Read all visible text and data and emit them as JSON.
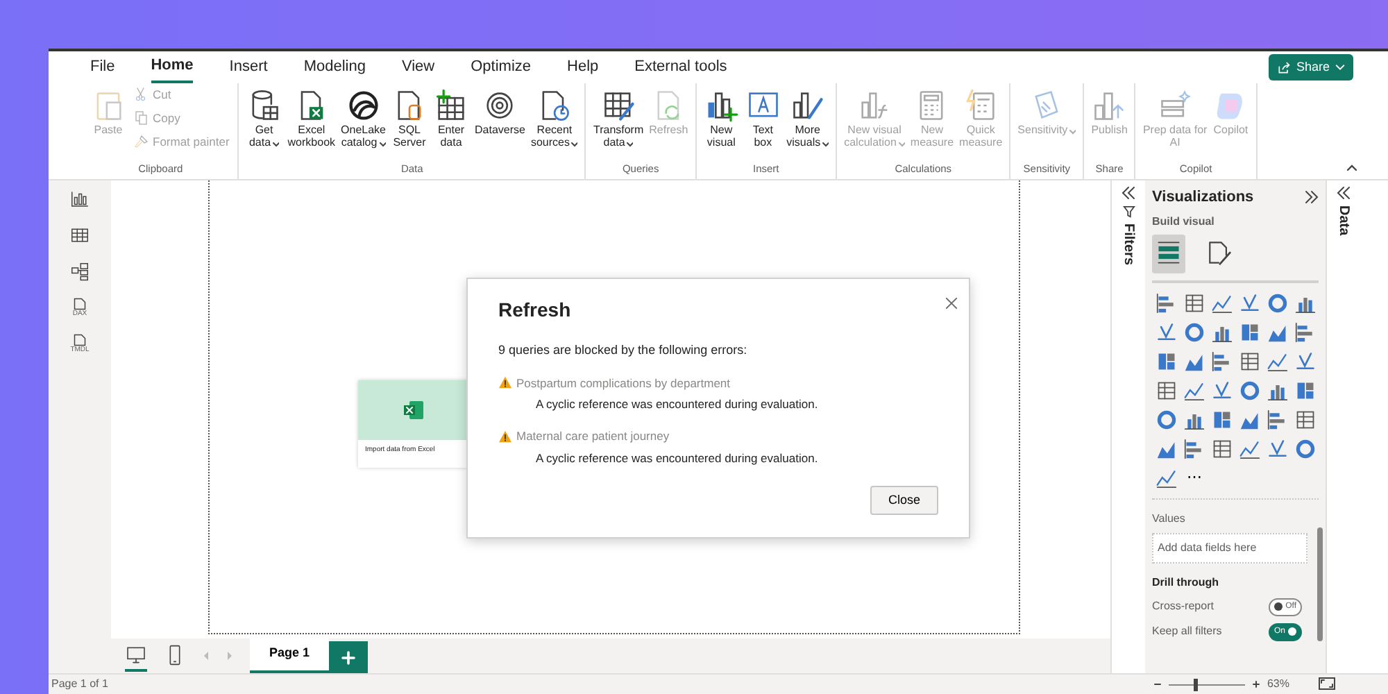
{
  "menu_tabs": [
    {
      "label": "File",
      "selected": false
    },
    {
      "label": "Home",
      "selected": true
    },
    {
      "label": "Insert",
      "selected": false
    },
    {
      "label": "Modeling",
      "selected": false
    },
    {
      "label": "View",
      "selected": false
    },
    {
      "label": "Optimize",
      "selected": false
    },
    {
      "label": "Help",
      "selected": false
    },
    {
      "label": "External tools",
      "selected": false
    }
  ],
  "share_button": {
    "label": "Share"
  },
  "ribbon": {
    "groups": [
      {
        "label": "Clipboard",
        "buttons": [
          {
            "kind": "large",
            "label": "Paste",
            "disabled": true,
            "dropdown": false
          },
          {
            "kind": "small",
            "label": "Cut",
            "disabled": true
          },
          {
            "kind": "small",
            "label": "Copy",
            "disabled": true
          },
          {
            "kind": "small",
            "label": "Format painter",
            "disabled": true
          }
        ]
      },
      {
        "label": "Data",
        "buttons": [
          {
            "kind": "large",
            "label": "Get\ndata",
            "disabled": false,
            "dropdown": true
          },
          {
            "kind": "large",
            "label": "Excel\nworkbook",
            "disabled": false,
            "dropdown": false
          },
          {
            "kind": "large",
            "label": "OneLake\ncatalog",
            "disabled": false,
            "dropdown": true
          },
          {
            "kind": "large",
            "label": "SQL\nServer",
            "disabled": false,
            "dropdown": false
          },
          {
            "kind": "large",
            "label": "Enter\ndata",
            "disabled": false,
            "dropdown": false
          },
          {
            "kind": "large",
            "label": "Dataverse",
            "disabled": false,
            "dropdown": false
          },
          {
            "kind": "large",
            "label": "Recent\nsources",
            "disabled": false,
            "dropdown": true
          }
        ]
      },
      {
        "label": "Queries",
        "buttons": [
          {
            "kind": "large",
            "label": "Transform\ndata",
            "disabled": false,
            "dropdown": true
          },
          {
            "kind": "large",
            "label": "Refresh",
            "disabled": true,
            "dropdown": false
          }
        ]
      },
      {
        "label": "Insert",
        "buttons": [
          {
            "kind": "large",
            "label": "New\nvisual",
            "disabled": false,
            "dropdown": false
          },
          {
            "kind": "large",
            "label": "Text\nbox",
            "disabled": false,
            "dropdown": false
          },
          {
            "kind": "large",
            "label": "More\nvisuals",
            "disabled": false,
            "dropdown": true
          }
        ]
      },
      {
        "label": "Calculations",
        "buttons": [
          {
            "kind": "large",
            "label": "New visual\ncalculation",
            "disabled": true,
            "dropdown": true
          },
          {
            "kind": "large",
            "label": "New\nmeasure",
            "disabled": true,
            "dropdown": false
          },
          {
            "kind": "large",
            "label": "Quick\nmeasure",
            "disabled": true,
            "dropdown": false
          }
        ]
      },
      {
        "label": "Sensitivity",
        "buttons": [
          {
            "kind": "large",
            "label": "Sensitivity",
            "disabled": true,
            "dropdown": true
          }
        ]
      },
      {
        "label": "Share",
        "buttons": [
          {
            "kind": "large",
            "label": "Publish",
            "disabled": true,
            "dropdown": false
          }
        ]
      },
      {
        "label": "Copilot",
        "buttons": [
          {
            "kind": "large",
            "label": "Prep data for\nAI",
            "disabled": true,
            "dropdown": false
          },
          {
            "kind": "large",
            "label": "Copilot",
            "disabled": true,
            "dropdown": false
          }
        ]
      }
    ]
  },
  "left_rail": [
    {
      "kind": "report"
    },
    {
      "kind": "table"
    },
    {
      "kind": "model"
    },
    {
      "kind": "dax",
      "badge": "DAX"
    },
    {
      "kind": "tmdl",
      "badge": "TMDL"
    }
  ],
  "canvas": {
    "card": {
      "caption": "Import data from Excel"
    }
  },
  "dialog": {
    "title": "Refresh",
    "message": "9 queries are blocked by the following errors:",
    "errors": [
      {
        "query": "Postpartum complications by department",
        "message": "A cyclic reference was encountered during evaluation."
      },
      {
        "query": "Maternal care patient journey",
        "message": "A cyclic reference was encountered during evaluation."
      }
    ],
    "button": "Close"
  },
  "filters_pane": {
    "label": "Filters"
  },
  "visualizations": {
    "title": "Visualizations",
    "subtitle": "Build visual",
    "build_tabs": [
      {
        "selected": true
      },
      {
        "selected": false
      }
    ],
    "more_label": "⋯",
    "values_label": "Values",
    "values_placeholder": "Add data fields here",
    "drill_title": "Drill through",
    "toggles": [
      {
        "label": "Cross-report",
        "on": false,
        "state_text": "Off"
      },
      {
        "label": "Keep all filters",
        "on": true,
        "state_text": "On"
      }
    ]
  },
  "data_pane": {
    "label": "Data"
  },
  "page_bar": {
    "views": [
      {
        "kind": "desktop",
        "selected": true
      },
      {
        "kind": "phone",
        "selected": false
      }
    ],
    "pages": [
      {
        "label": "Page 1",
        "selected": true
      }
    ]
  },
  "status_bar": {
    "page_text": "Page 1 of 1",
    "zoom": {
      "level": 0.33,
      "reading": "63%"
    }
  }
}
